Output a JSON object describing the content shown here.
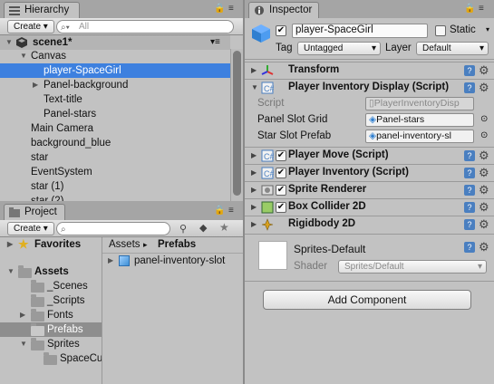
{
  "hierarchy": {
    "tab_label": "Hierarchy",
    "create_label": "Create",
    "search_placeholder": "All",
    "scene_label": "scene1*",
    "items": [
      {
        "label": "Canvas"
      },
      {
        "label": "player-SpaceGirl"
      },
      {
        "label": "Panel-background"
      },
      {
        "label": "Text-title"
      },
      {
        "label": "Panel-stars"
      },
      {
        "label": "Main Camera"
      },
      {
        "label": "background_blue"
      },
      {
        "label": "star"
      },
      {
        "label": "EventSystem"
      },
      {
        "label": "star (1)"
      },
      {
        "label": "star (2)"
      }
    ]
  },
  "project": {
    "tab_label": "Project",
    "create_label": "Create",
    "favorites_label": "Favorites",
    "assets_label": "Assets",
    "folders": [
      {
        "label": "_Scenes"
      },
      {
        "label": "_Scripts"
      },
      {
        "label": "Fonts"
      },
      {
        "label": "Prefabs"
      },
      {
        "label": "Sprites"
      },
      {
        "label": "SpaceCu"
      }
    ],
    "breadcrumb": [
      "Assets",
      "▸",
      "Prefabs"
    ],
    "asset_item": "panel-inventory-slot"
  },
  "inspector": {
    "tab_label": "Inspector",
    "object_name": "player-SpaceGirl",
    "static_label": "Static",
    "tag_label": "Tag",
    "tag_value": "Untagged",
    "layer_label": "Layer",
    "layer_value": "Default",
    "components": [
      {
        "title": "Transform"
      },
      {
        "title": "Player Inventory Display (Script)"
      },
      {
        "title": "Player Move (Script)"
      },
      {
        "title": "Player Inventory (Script)"
      },
      {
        "title": "Sprite Renderer"
      },
      {
        "title": "Box Collider 2D"
      },
      {
        "title": "Rigidbody 2D"
      }
    ],
    "script_label": "Script",
    "script_value": "PlayerInventoryDisp",
    "panel_slot_label": "Panel Slot Grid",
    "panel_slot_value": "Panel-stars",
    "star_slot_label": "Star Slot Prefab",
    "star_slot_value": "panel-inventory-sl",
    "material_name": "Sprites-Default",
    "shader_label": "Shader",
    "shader_value": "Sprites/Default",
    "add_component_label": "Add Component"
  },
  "colors": {
    "selection": "#3d80df",
    "panel": "#c2c2c2",
    "help": "#4a7fc0"
  }
}
